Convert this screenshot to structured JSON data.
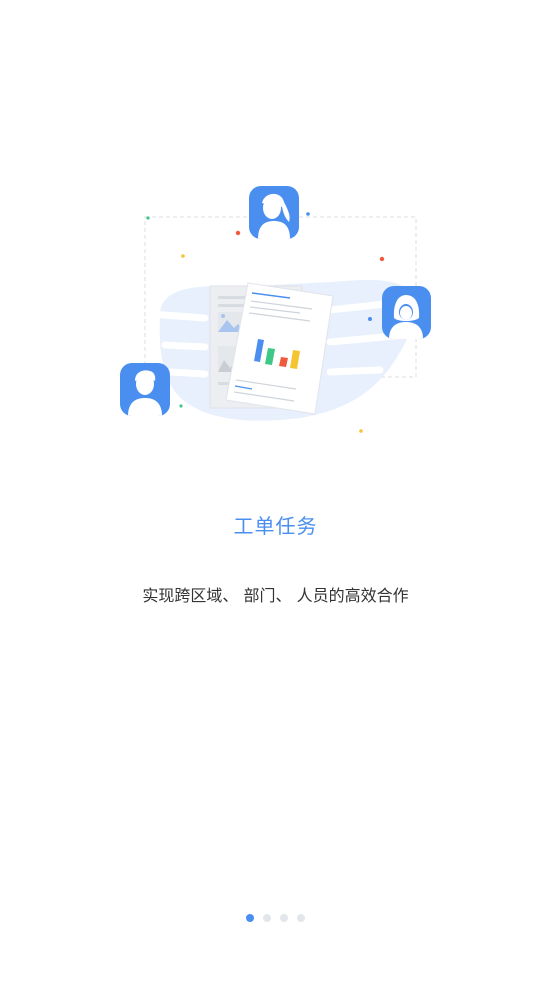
{
  "onboarding": {
    "title": "工单任务",
    "subtitle": "实现跨区域、 部门、 人员的高效合作",
    "pages_total": 4,
    "current_page": 1
  },
  "colors": {
    "accent": "#4a8ff0",
    "blob": "#e8effd",
    "dot_inactive": "#e3e6eb",
    "bar_blue": "#4a8ff0",
    "bar_green": "#3ec887",
    "bar_red": "#f05a3c",
    "bar_yellow": "#f5c431"
  },
  "icons": [
    "woman-ponytail-avatar-icon",
    "woman-long-hair-avatar-icon",
    "man-avatar-icon",
    "document-chart-icon",
    "image-placeholder-icon"
  ]
}
